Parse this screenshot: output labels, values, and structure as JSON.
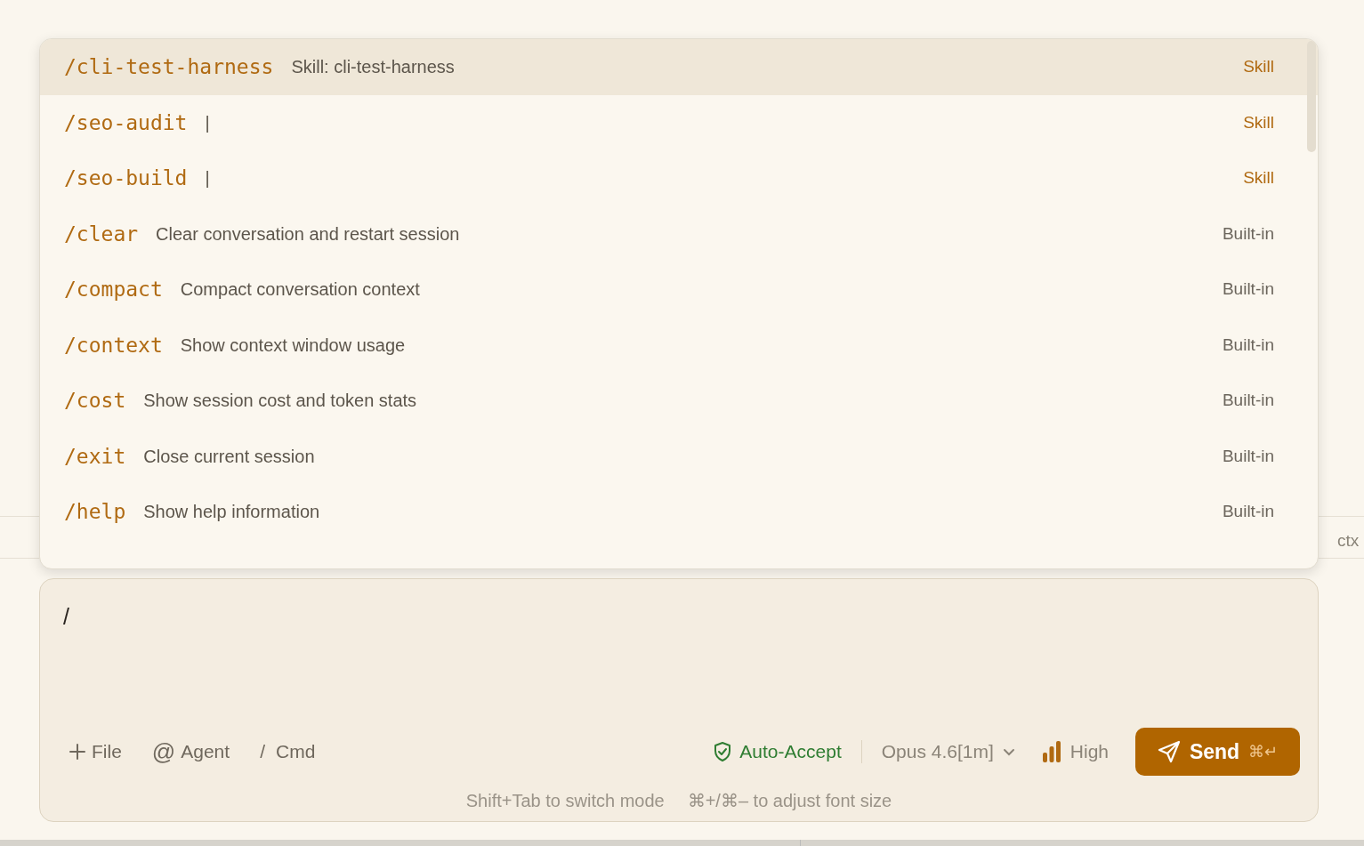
{
  "background": {
    "ctx_label": "ctx"
  },
  "command_menu": {
    "items": [
      {
        "command": "/cli-test-harness",
        "description": "Skill: cli-test-harness",
        "source": "Skill",
        "kind": "skill",
        "selected": true
      },
      {
        "command": "/seo-audit",
        "description": "|",
        "source": "Skill",
        "kind": "skill",
        "selected": false
      },
      {
        "command": "/seo-build",
        "description": "|",
        "source": "Skill",
        "kind": "skill",
        "selected": false
      },
      {
        "command": "/clear",
        "description": "Clear conversation and restart session",
        "source": "Built-in",
        "kind": "builtin",
        "selected": false
      },
      {
        "command": "/compact",
        "description": "Compact conversation context",
        "source": "Built-in",
        "kind": "builtin",
        "selected": false
      },
      {
        "command": "/context",
        "description": "Show context window usage",
        "source": "Built-in",
        "kind": "builtin",
        "selected": false
      },
      {
        "command": "/cost",
        "description": "Show session cost and token stats",
        "source": "Built-in",
        "kind": "builtin",
        "selected": false
      },
      {
        "command": "/exit",
        "description": "Close current session",
        "source": "Built-in",
        "kind": "builtin",
        "selected": false
      },
      {
        "command": "/help",
        "description": "Show help information",
        "source": "Built-in",
        "kind": "builtin",
        "selected": false
      }
    ]
  },
  "composer": {
    "value": "/",
    "actions": [
      {
        "kind": "file",
        "label": "File"
      },
      {
        "kind": "agent",
        "glyph": "@",
        "label": "Agent"
      },
      {
        "kind": "cmd",
        "glyph": "/",
        "label": "Cmd"
      }
    ],
    "mode": {
      "label": "Auto-Accept"
    },
    "model": {
      "label": "Opus 4.6[1m]"
    },
    "effort": {
      "label": "High"
    },
    "send": {
      "label": "Send",
      "shortcut": "⌘↵"
    },
    "hints": [
      "Shift+Tab to switch mode",
      "⌘+/⌘– to adjust font size"
    ]
  }
}
